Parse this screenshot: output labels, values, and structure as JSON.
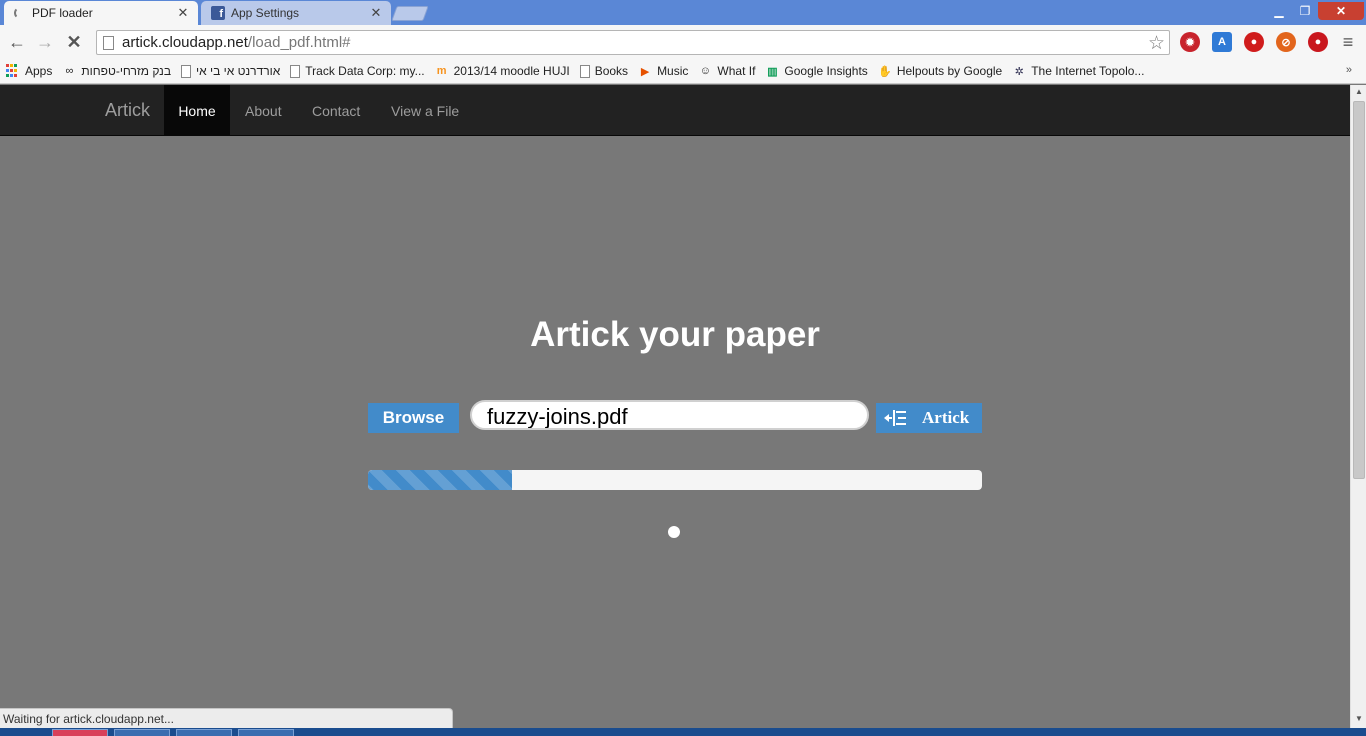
{
  "browser": {
    "tabs": [
      {
        "title": "PDF loader",
        "icon": "loading-spinner-icon",
        "active": true
      },
      {
        "title": "App Settings",
        "icon": "facebook-icon",
        "active": false
      }
    ],
    "close_glyph": "✕",
    "url": {
      "host": "artick.cloudapp.net",
      "path": "/load_pdf.html#"
    },
    "bookmarks": [
      {
        "label": "Apps",
        "icon": "apps-grid-icon"
      },
      {
        "label": "בנק מזרחי-טפחות",
        "icon": "mizrahi-bank-icon"
      },
      {
        "label": "אורדרנט אי בי אי",
        "icon": "page-icon"
      },
      {
        "label": "Track Data Corp: my...",
        "icon": "page-icon"
      },
      {
        "label": "2013/14 moodle HUJI",
        "icon": "moodle-icon"
      },
      {
        "label": "Books",
        "icon": "page-icon"
      },
      {
        "label": "Music",
        "icon": "play-music-icon"
      },
      {
        "label": "What If",
        "icon": "xkcd-icon"
      },
      {
        "label": "Google Insights",
        "icon": "insights-icon"
      },
      {
        "label": "Helpouts by Google",
        "icon": "helpouts-icon"
      },
      {
        "label": "The Internet Topolo...",
        "icon": "topology-icon"
      }
    ],
    "status_text": "Waiting for artick.cloudapp.net..."
  },
  "site": {
    "brand": "Artick",
    "nav": [
      {
        "label": "Home",
        "active": true
      },
      {
        "label": "About",
        "active": false
      },
      {
        "label": "Contact",
        "active": false
      },
      {
        "label": "View a File",
        "active": false
      }
    ]
  },
  "main": {
    "title": "Artick your paper",
    "browse_label": "Browse",
    "file_name": "fuzzy-joins.pdf",
    "submit_label": "Artick",
    "progress": 0.235
  },
  "colors": {
    "accent": "#428bca",
    "navbar": "#222222",
    "page_bg": "#787878"
  }
}
